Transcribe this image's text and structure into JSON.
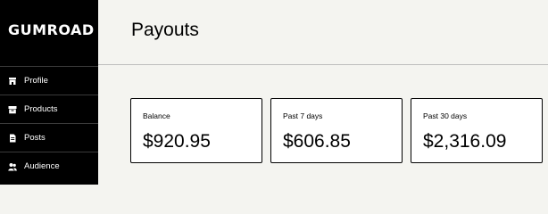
{
  "brand": {
    "logo_text": "GUMROAD"
  },
  "sidebar": {
    "items": [
      {
        "label": "Profile",
        "icon": "shop-icon"
      },
      {
        "label": "Products",
        "icon": "archive-icon"
      },
      {
        "label": "Posts",
        "icon": "document-icon"
      },
      {
        "label": "Audience",
        "icon": "people-icon"
      }
    ]
  },
  "header": {
    "title": "Payouts"
  },
  "cards": [
    {
      "label": "Balance",
      "value": "$920.95"
    },
    {
      "label": "Past 7 days",
      "value": "$606.85"
    },
    {
      "label": "Past 30 days",
      "value": "$2,316.09"
    }
  ],
  "colors": {
    "sidebar_bg": "#000000",
    "page_bg": "#f4f4f0",
    "card_bg": "#ffffff"
  }
}
